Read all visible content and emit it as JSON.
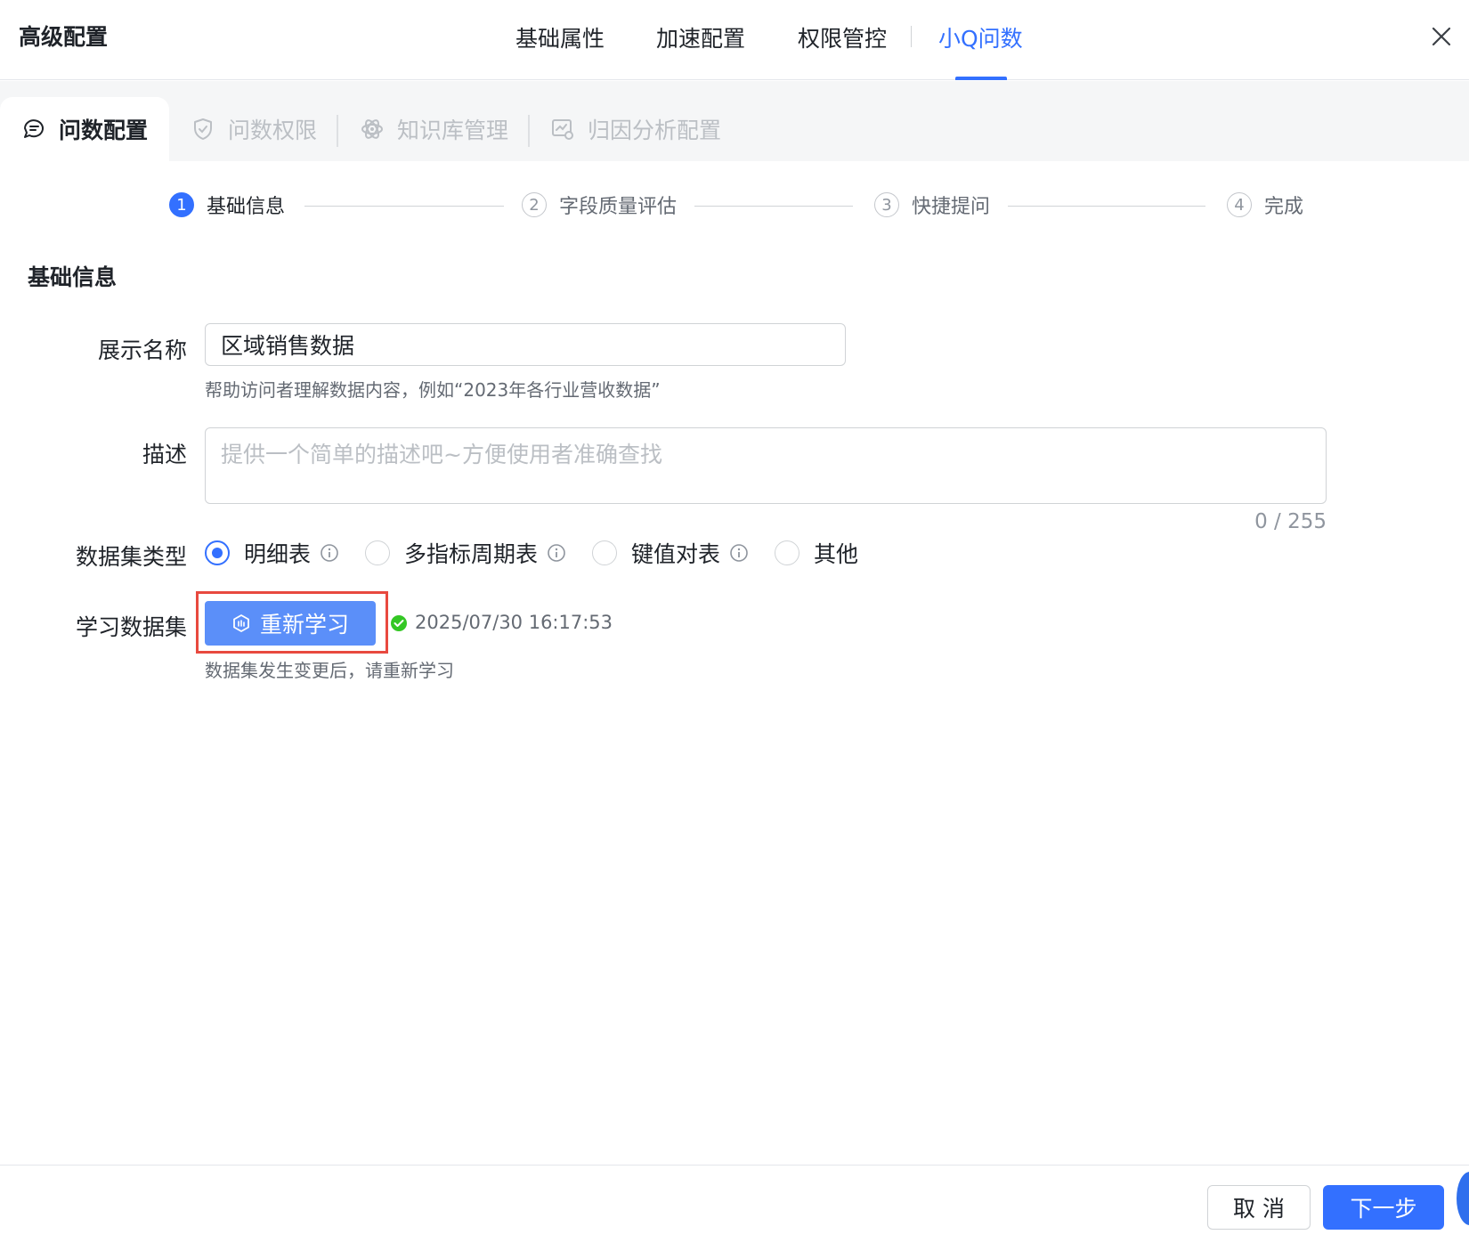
{
  "header": {
    "title": "高级配置",
    "tabs": [
      {
        "label": "基础属性",
        "active": false
      },
      {
        "label": "加速配置",
        "active": false
      },
      {
        "label": "权限管控",
        "active": false
      },
      {
        "label": "小Q问数",
        "active": true
      }
    ],
    "close_icon": "close-icon"
  },
  "subtabs": [
    {
      "label": "问数配置",
      "icon": "chat-bubble-icon",
      "active": true
    },
    {
      "label": "问数权限",
      "icon": "shield-check-icon",
      "active": false
    },
    {
      "label": "知识库管理",
      "icon": "atom-icon",
      "active": false
    },
    {
      "label": "归因分析配置",
      "icon": "analysis-chart-icon",
      "active": false
    }
  ],
  "steps": [
    {
      "num": "1",
      "label": "基础信息",
      "active": true
    },
    {
      "num": "2",
      "label": "字段质量评估",
      "active": false
    },
    {
      "num": "3",
      "label": "快捷提问",
      "active": false
    },
    {
      "num": "4",
      "label": "完成",
      "active": false
    }
  ],
  "form": {
    "section_title": "基础信息",
    "display_name": {
      "label": "展示名称",
      "value": "区域销售数据",
      "help": "帮助访问者理解数据内容，例如“2023年各行业营收数据”"
    },
    "description": {
      "label": "描述",
      "placeholder": "提供一个简单的描述吧~方便使用者准确查找",
      "counter": "0 / 255"
    },
    "dataset_type": {
      "label": "数据集类型",
      "options": [
        {
          "label": "明细表",
          "checked": true,
          "info": true
        },
        {
          "label": "多指标周期表",
          "checked": false,
          "info": true
        },
        {
          "label": "键值对表",
          "checked": false,
          "info": true
        },
        {
          "label": "其他",
          "checked": false,
          "info": false
        }
      ]
    },
    "learn": {
      "label": "学习数据集",
      "button": "重新学习",
      "timestamp": "2025/07/30 16:17:53",
      "help": "数据集发生变更后，请重新学习"
    }
  },
  "footer": {
    "cancel": "取 消",
    "next": "下一步"
  },
  "colors": {
    "primary": "#3370ff",
    "learn_button": "#5b8ff9",
    "highlight": "#e8493f",
    "success": "#34c724"
  }
}
